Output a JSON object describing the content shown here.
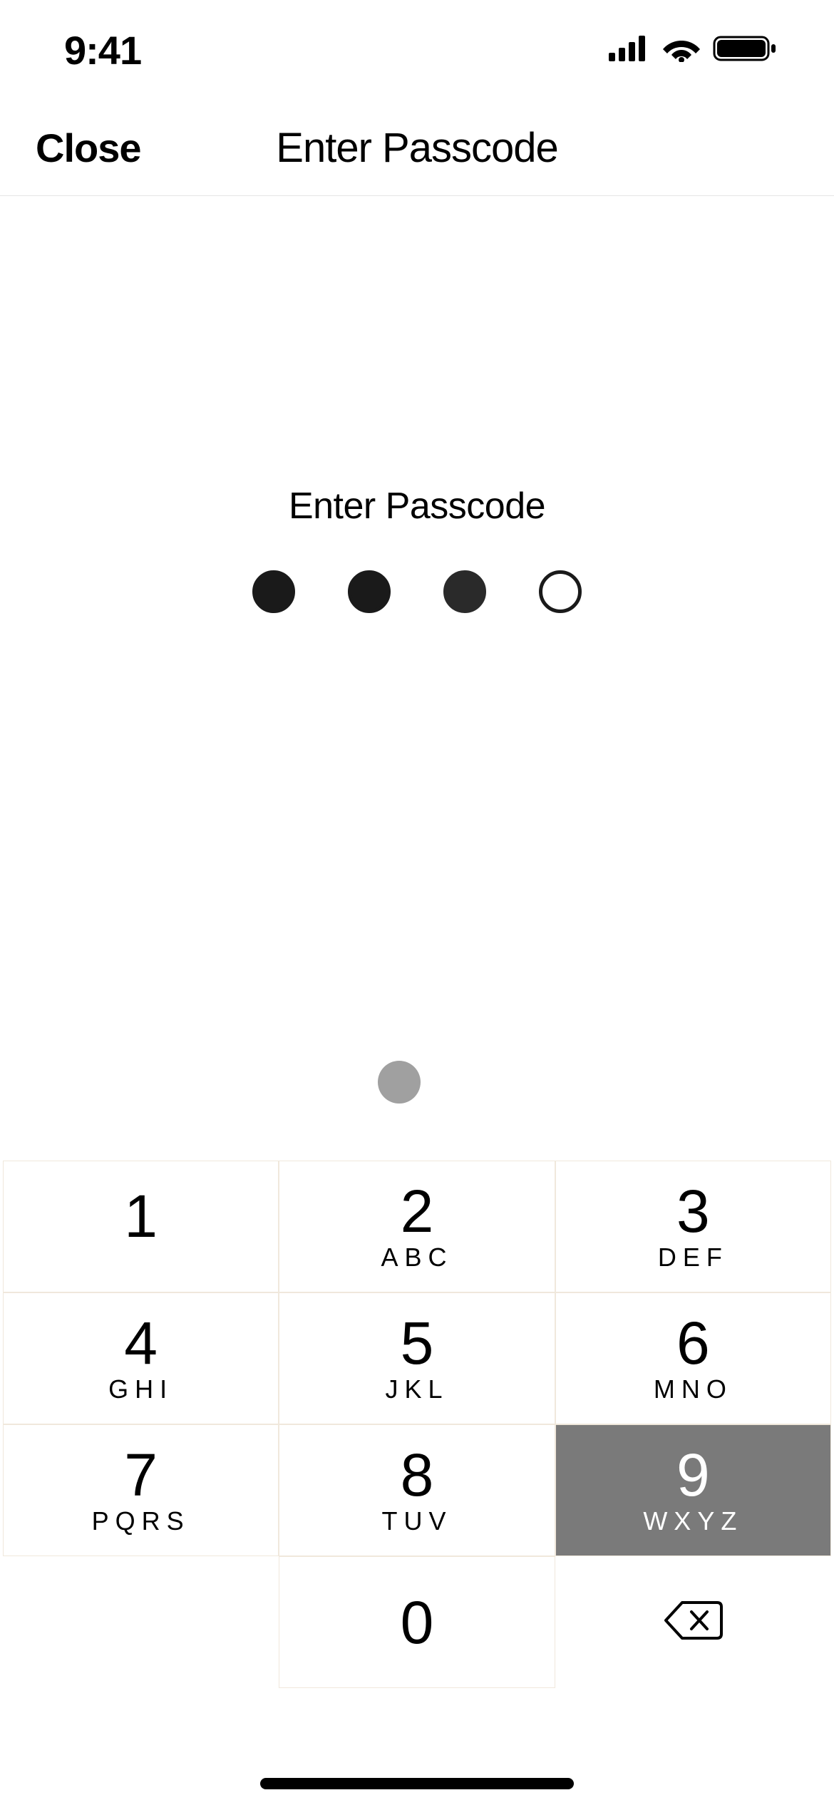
{
  "status_bar": {
    "time": "9:41"
  },
  "nav": {
    "close_label": "Close",
    "title": "Enter Passcode"
  },
  "prompt": {
    "label": "Enter Passcode",
    "dots": [
      {
        "state": "filled"
      },
      {
        "state": "filled"
      },
      {
        "state": "filling"
      },
      {
        "state": "empty"
      }
    ]
  },
  "keypad": {
    "keys": [
      {
        "number": "1",
        "letters": ""
      },
      {
        "number": "2",
        "letters": "ABC"
      },
      {
        "number": "3",
        "letters": "DEF"
      },
      {
        "number": "4",
        "letters": "GHI"
      },
      {
        "number": "5",
        "letters": "JKL"
      },
      {
        "number": "6",
        "letters": "MNO"
      },
      {
        "number": "7",
        "letters": "PQRS"
      },
      {
        "number": "8",
        "letters": "TUV"
      },
      {
        "number": "9",
        "letters": "WXYZ",
        "active": true
      },
      {
        "blank": true
      },
      {
        "number": "0",
        "letters": ""
      },
      {
        "backspace": true
      }
    ]
  }
}
